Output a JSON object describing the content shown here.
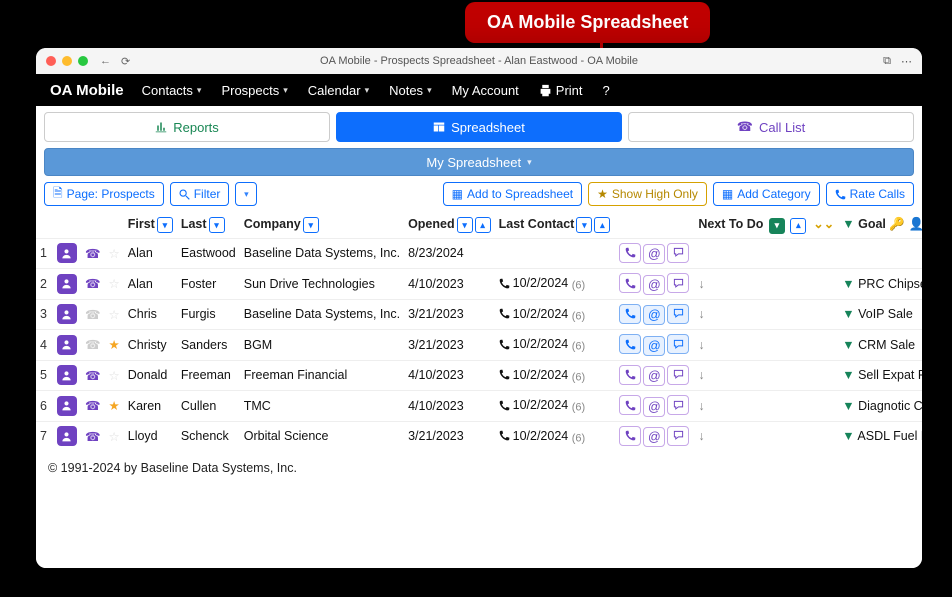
{
  "annotation": "OA Mobile Spreadsheet",
  "window_title": "OA Mobile - Prospects Spreadsheet - Alan Eastwood - OA Mobile",
  "brand": "OA Mobile",
  "menu": [
    "Contacts",
    "Prospects",
    "Calendar",
    "Notes",
    "My Account",
    "Print",
    "?"
  ],
  "menu_has_caret": [
    true,
    true,
    true,
    true,
    false,
    false,
    false
  ],
  "menu_print_idx": 5,
  "tabs": {
    "reports": "Reports",
    "spreadsheet": "Spreadsheet",
    "call_list": "Call List"
  },
  "subbar": "My Spreadsheet",
  "toolbar": {
    "page": "Page: Prospects",
    "filter": "Filter",
    "add": "Add to Spreadsheet",
    "high": "Show High Only",
    "cat": "Add Category",
    "rate": "Rate Calls"
  },
  "headers": {
    "first": "First",
    "last": "Last",
    "company": "Company",
    "opened": "Opened",
    "last_contact": "Last Contact",
    "next": "Next To Do",
    "goal": "Goal"
  },
  "rows": [
    {
      "n": "1",
      "p": true,
      "star": false,
      "first": "Alan",
      "last": "Eastwood",
      "company": "Baseline Data Systems, Inc.",
      "opened": "8/23/2024",
      "lc": "",
      "lcn": "",
      "sel": false,
      "arrow": false,
      "goal": ""
    },
    {
      "n": "2",
      "p": true,
      "star": false,
      "first": "Alan",
      "last": "Foster",
      "company": "Sun Drive Technologies",
      "opened": "4/10/2023",
      "lc": "10/2/2024",
      "lcn": "(6)",
      "sel": false,
      "arrow": true,
      "goal": "PRC Chipset Sales"
    },
    {
      "n": "3",
      "p": false,
      "star": false,
      "first": "Chris",
      "last": "Furgis",
      "company": "Baseline Data Systems, Inc.",
      "opened": "3/21/2023",
      "lc": "10/2/2024",
      "lcn": "(6)",
      "sel": true,
      "arrow": true,
      "goal": "VoIP Sale"
    },
    {
      "n": "4",
      "p": false,
      "star": true,
      "first": "Christy",
      "last": "Sanders",
      "company": "BGM",
      "opened": "3/21/2023",
      "lc": "10/2/2024",
      "lcn": "(6)",
      "sel": true,
      "arrow": true,
      "goal": "CRM Sale"
    },
    {
      "n": "5",
      "p": true,
      "star": false,
      "first": "Donald",
      "last": "Freeman",
      "company": "Freeman Financial",
      "opened": "4/10/2023",
      "lc": "10/2/2024",
      "lcn": "(6)",
      "sel": false,
      "arrow": true,
      "goal": "Sell Expat Financial Guide"
    },
    {
      "n": "6",
      "p": true,
      "star": true,
      "first": "Karen",
      "last": "Cullen",
      "company": "TMC",
      "opened": "4/10/2023",
      "lc": "10/2/2024",
      "lcn": "(6)",
      "sel": false,
      "arrow": true,
      "goal": "Diagnotic Chipset Sales"
    },
    {
      "n": "7",
      "p": true,
      "star": false,
      "first": "Lloyd",
      "last": "Schenck",
      "company": "Orbital Science",
      "opened": "3/21/2023",
      "lc": "10/2/2024",
      "lcn": "(6)",
      "sel": false,
      "arrow": true,
      "goal": "ASDL Fuel Regulator Sales"
    }
  ],
  "footer": "© 1991-2024 by Baseline Data Systems, Inc."
}
